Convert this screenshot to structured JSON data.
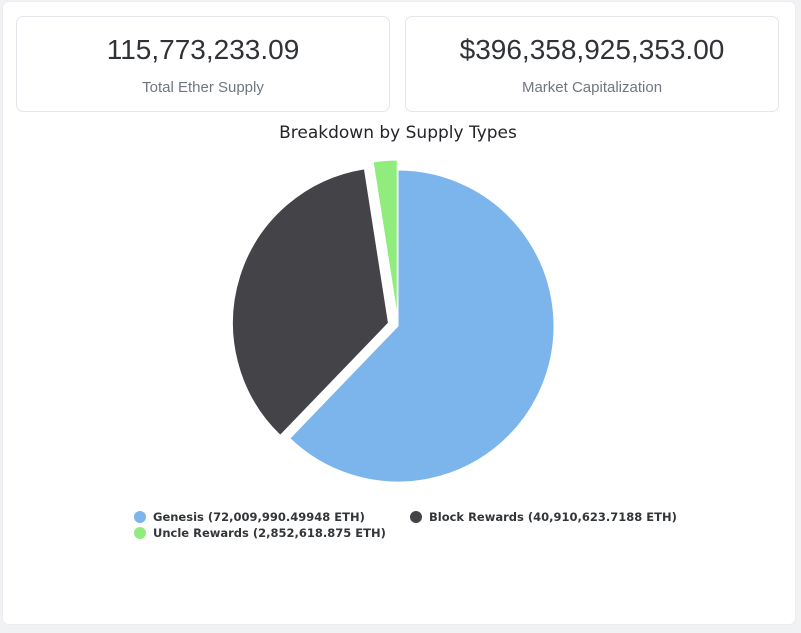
{
  "stats": {
    "total_supply_value": "115,773,233.09",
    "total_supply_label": "Total Ether Supply",
    "market_cap_value": "$396,358,925,353.00",
    "market_cap_label": "Market Capitalization"
  },
  "chart_data": {
    "type": "pie",
    "title": "Breakdown by Supply Types",
    "slices": [
      {
        "label": "Genesis (72,009,990.49948 ETH)",
        "value": 72009990.49948,
        "color": "#7cb5ec",
        "exploded": false
      },
      {
        "label": "Block Rewards (40,910,623.7188 ETH)",
        "value": 40910623.7188,
        "color": "#434348",
        "exploded": true
      },
      {
        "label": "Uncle Rewards (2,852,618.875 ETH)",
        "value": 2852618.875,
        "color": "#90ed7d",
        "exploded": true
      }
    ],
    "legend_position": "bottom"
  }
}
